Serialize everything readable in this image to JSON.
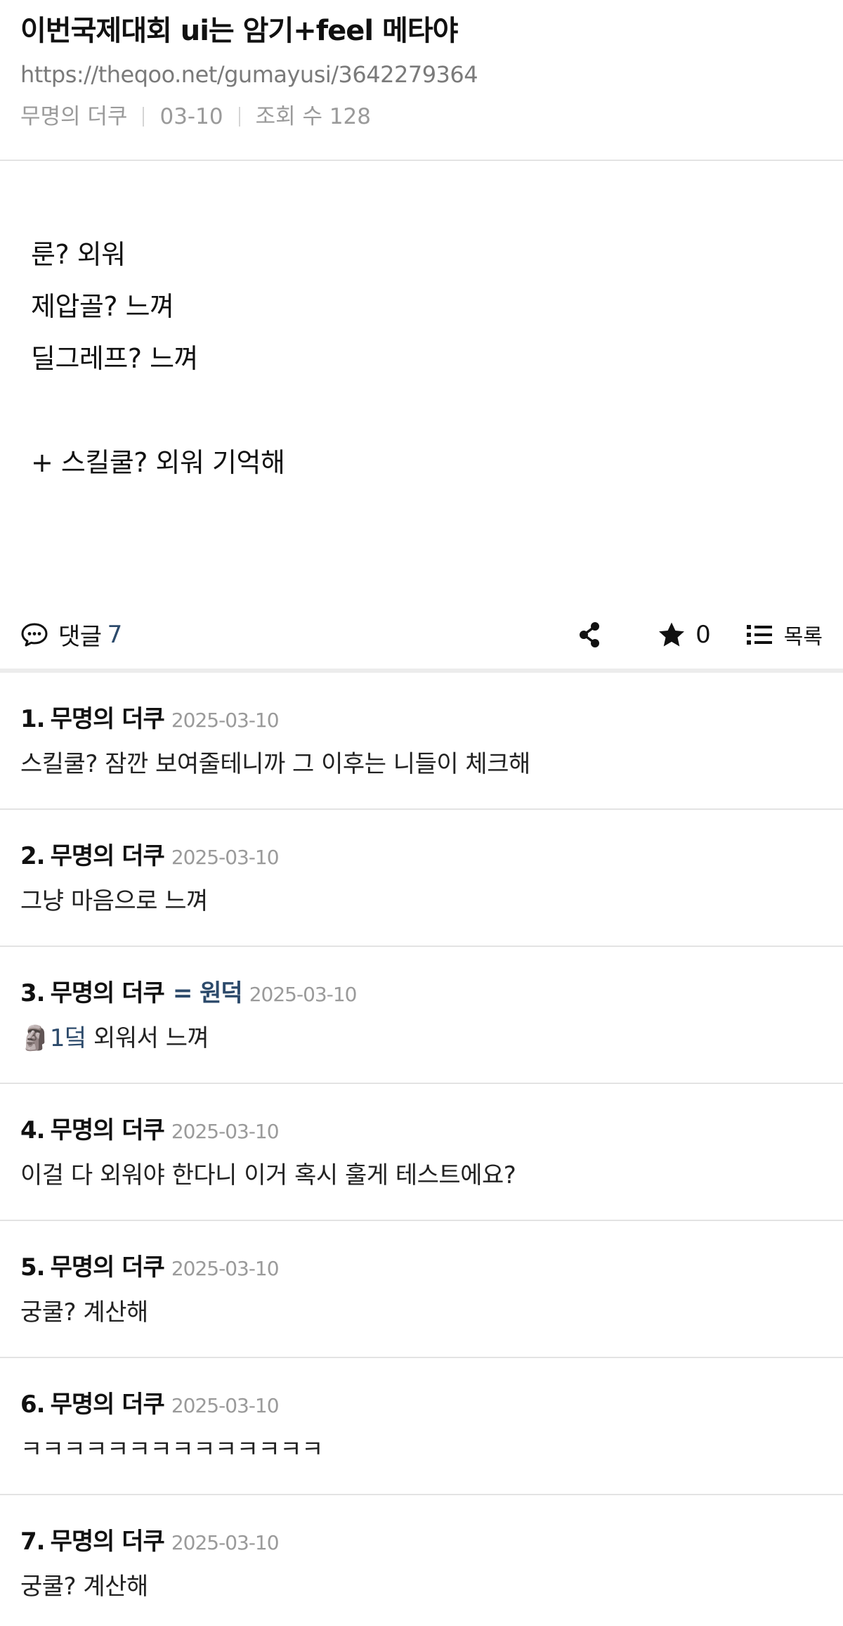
{
  "post": {
    "title": "이번국제대회 ui는 암기+feel 메타야",
    "url": "https://theqoo.net/gumayusi/3642279364",
    "author": "무명의 더쿠",
    "date": "03-10",
    "views_label": "조회 수 128",
    "body_lines": [
      "룬? 외워",
      "제압골? 느껴",
      "딜그레프? 느껴",
      "",
      "+ 스킬쿨? 외워 기억해"
    ]
  },
  "actions": {
    "comment_label": "댓글",
    "comment_count": "7",
    "star_count": "0",
    "list_label": "목록",
    "icons": [
      "comment-icon",
      "share-icon",
      "star-icon",
      "list-icon"
    ]
  },
  "colors": {
    "accent": "#2c4a6b",
    "meta_gray": "#9a9a9a",
    "divider": "#e3e3e3"
  },
  "comments": [
    {
      "num": "1.",
      "author": "무명의 더쿠",
      "tag": "",
      "date": "2025-03-10",
      "reply_ref": "",
      "text": "스킬쿨? 잠깐 보여줄테니까 그 이후는 니들이 체크해"
    },
    {
      "num": "2.",
      "author": "무명의 더쿠",
      "tag": "",
      "date": "2025-03-10",
      "reply_ref": "",
      "text": "그냥 마음으로 느껴"
    },
    {
      "num": "3.",
      "author": "무명의 더쿠",
      "tag": "= 원덕",
      "date": "2025-03-10",
      "reply_ref": "🗿1덬",
      "text": " 외워서 느껴"
    },
    {
      "num": "4.",
      "author": "무명의 더쿠",
      "tag": "",
      "date": "2025-03-10",
      "reply_ref": "",
      "text": "이걸 다 외워야 한다니 이거 혹시 훌게 테스트에요?"
    },
    {
      "num": "5.",
      "author": "무명의 더쿠",
      "tag": "",
      "date": "2025-03-10",
      "reply_ref": "",
      "text": "궁쿨? 계산해"
    },
    {
      "num": "6.",
      "author": "무명의 더쿠",
      "tag": "",
      "date": "2025-03-10",
      "reply_ref": "",
      "text": "ㅋㅋㅋㅋㅋㅋㅋㅋㅋㅋㅋㅋㅋㅋ"
    },
    {
      "num": "7.",
      "author": "무명의 더쿠",
      "tag": "",
      "date": "2025-03-10",
      "reply_ref": "",
      "text": "궁쿨? 계산해"
    }
  ]
}
